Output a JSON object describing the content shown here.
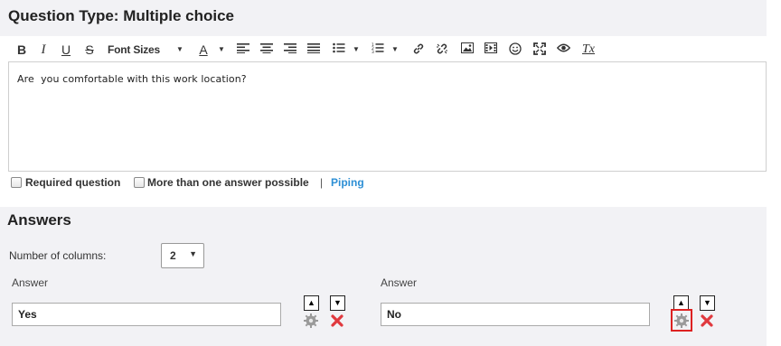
{
  "question": {
    "title": "Question Type: Multiple choice",
    "text": "Are  you comfortable with this work location?"
  },
  "toolbar": {
    "bold": "B",
    "italic": "I",
    "underline": "U",
    "strike": "S",
    "font_sizes": "Font Sizes",
    "font_color": "A",
    "clear_format": "Tx"
  },
  "options": {
    "required_label": "Required question",
    "required_checked": false,
    "multi_label": "More than one answer possible",
    "multi_checked": false,
    "separator": "|",
    "piping_label": "Piping"
  },
  "answers": {
    "title": "Answers",
    "columns_label": "Number of columns:",
    "columns_value": "2",
    "items": [
      {
        "label": "Answer",
        "value": "Yes",
        "up": "▲",
        "down": "▼"
      },
      {
        "label": "Answer",
        "value": "No",
        "up": "▲",
        "down": "▼"
      }
    ]
  },
  "colors": {
    "panel_bg": "#f2f2f5",
    "link": "#2d8fd5",
    "delete": "#e0393e",
    "highlight": "#dd2222"
  }
}
